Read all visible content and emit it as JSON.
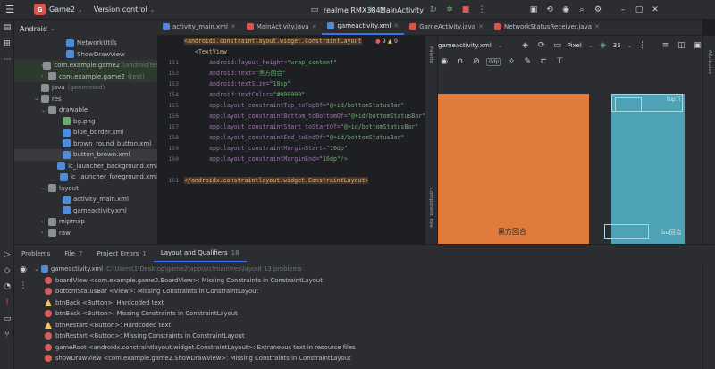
{
  "titlebar": {
    "project_badge": "G",
    "project": "Game2",
    "version_control": "Version control",
    "device": "realme RMX3841",
    "run_config": "MainActivity"
  },
  "left_strip_icons": [
    "folder-icon",
    "grid-icon",
    "ellipsis-icon"
  ],
  "tree": {
    "header": "Android",
    "rows": [
      {
        "label": "NetworkUtils",
        "indent": 50,
        "icon": "blue",
        "arrow": ""
      },
      {
        "label": "ShowDrawView",
        "indent": 50,
        "icon": "blue",
        "arrow": ""
      },
      {
        "label": "com.example.game2",
        "suffix": "(androidTest)",
        "indent": 30,
        "icon": "folder",
        "arrow": "›",
        "green": true
      },
      {
        "label": "com.example.game2",
        "suffix": "(test)",
        "indent": 30,
        "icon": "folder",
        "arrow": "›",
        "green": true
      },
      {
        "label": "java",
        "suffix": "(generated)",
        "indent": 22,
        "icon": "folder",
        "arrow": ""
      },
      {
        "label": "res",
        "indent": 22,
        "icon": "folder",
        "arrow": "⌄"
      },
      {
        "label": "drawable",
        "indent": 30,
        "icon": "folder",
        "arrow": "⌄"
      },
      {
        "label": "bg.png",
        "indent": 46,
        "icon": "img",
        "arrow": ""
      },
      {
        "label": "blue_border.xml",
        "indent": 46,
        "icon": "xml",
        "arrow": ""
      },
      {
        "label": "brown_round_button.xml",
        "indent": 46,
        "icon": "xml",
        "arrow": ""
      },
      {
        "label": "button_brown.xml",
        "indent": 46,
        "icon": "xml",
        "arrow": "",
        "selected": true
      },
      {
        "label": "ic_launcher_background.xml",
        "indent": 46,
        "icon": "xml",
        "arrow": ""
      },
      {
        "label": "ic_launcher_foreground.xml",
        "indent": 46,
        "icon": "xml",
        "arrow": ""
      },
      {
        "label": "layout",
        "indent": 30,
        "icon": "folder",
        "arrow": "⌄"
      },
      {
        "label": "activity_main.xml",
        "indent": 46,
        "icon": "xml",
        "arrow": ""
      },
      {
        "label": "gameactivity.xml",
        "indent": 46,
        "icon": "xml",
        "arrow": ""
      },
      {
        "label": "mipmap",
        "indent": 30,
        "icon": "folder",
        "arrow": "›"
      },
      {
        "label": "raw",
        "indent": 30,
        "icon": "folder",
        "arrow": "›"
      }
    ]
  },
  "tabs": [
    {
      "label": "activity_main.xml",
      "active": false,
      "color": "#4f8bd6"
    },
    {
      "label": "MainActivity.java",
      "active": false,
      "color": "#d9534f"
    },
    {
      "label": "gameactivity.xml",
      "active": true,
      "color": "#4f8bd6"
    },
    {
      "label": "GameActivity.java",
      "active": false,
      "color": "#d9534f"
    },
    {
      "label": "NetworkStatusReceiver.java",
      "active": false,
      "color": "#d9534f"
    }
  ],
  "gutter": [
    "",
    "",
    "151",
    "152",
    "153",
    "154",
    "155",
    "156",
    "157",
    "158",
    "159",
    "160",
    "",
    "161"
  ],
  "editor": {
    "warnings": {
      "errors": "9",
      "warns": "9"
    },
    "lines": [
      {
        "tag": "<androidx.constraintlayout.widget.ConstraintLayout",
        "hl": true,
        "indent": 0
      },
      {
        "tag": "<TextView",
        "indent": 12
      },
      {
        "attr": "android:layout_height=",
        "val": "\"wrap_content\"",
        "indent": 28
      },
      {
        "attr": "android:text=",
        "val": "\"黑方回合\"",
        "indent": 28
      },
      {
        "attr": "android:textSize=",
        "val": "\"18sp\"",
        "indent": 28
      },
      {
        "attr": "android:textColor=",
        "val": "\"#000000\"",
        "indent": 28
      },
      {
        "attr": "app:layout_constraintTop_toTopOf=",
        "val": "\"@+id/bottomStatusBar\"",
        "indent": 28
      },
      {
        "attr": "app:layout_constraintBottom_toBottomOf=",
        "val": "\"@+id/bottomStatusBar\"",
        "indent": 28
      },
      {
        "attr": "app:layout_constraintStart_toStartOf=",
        "val": "\"@+id/bottomStatusBar\"",
        "indent": 28
      },
      {
        "attr": "app:layout_constraintEnd_toEndOf=",
        "val": "\"@+id/bottomStatusBar\"",
        "indent": 28
      },
      {
        "attr": "app:layout_constraintMarginStart=",
        "val": "\"16dp\"",
        "indent": 28
      },
      {
        "attr": "app:layout_constraintMarginEnd=",
        "val": "\"16dp\"/>",
        "indent": 28
      },
      {
        "tag": "",
        "indent": 0
      },
      {
        "tag": "</androidx.constraintlayout.widget.ConstraintLayout>",
        "hl": true,
        "indent": 0
      }
    ]
  },
  "preview": {
    "file": "gameactivity.xml",
    "device": "Pixel",
    "api": "35",
    "dp_value": "0dp",
    "label_board": "黑方回合",
    "label_right": "bo回合",
    "label_topright": "topTi"
  },
  "preview_side": {
    "palette": "Palette",
    "component_tree": "Component Tree"
  },
  "right_strip": {
    "attributes": "Attributes"
  },
  "bottom": {
    "tabs": [
      {
        "label": "Problems",
        "count": "",
        "active": false
      },
      {
        "label": "File",
        "count": "7",
        "active": false
      },
      {
        "label": "Project Errors",
        "count": "1",
        "active": false
      },
      {
        "label": "Layout and Qualifiers",
        "count": "18",
        "active": true
      }
    ],
    "file_row": {
      "name": "gameactivity.xml",
      "path": "C:\\Users\\1\\Desktop\\game2\\app\\src\\main\\res\\layout  13 problems"
    },
    "problems": [
      {
        "type": "error",
        "text": "boardView <com.example.game2.BoardView>: Missing Constraints in ConstraintLayout"
      },
      {
        "type": "error",
        "text": "bottomStatusBar <View>: Missing Constraints in ConstraintLayout"
      },
      {
        "type": "warning",
        "text": "btnBack <Button>: Hardcoded text"
      },
      {
        "type": "error",
        "text": "btnBack <Button>: Missing Constraints in ConstraintLayout"
      },
      {
        "type": "warning",
        "text": "btnRestart <Button>: Hardcoded text"
      },
      {
        "type": "error",
        "text": "btnRestart <Button>: Missing Constraints in ConstraintLayout"
      },
      {
        "type": "error",
        "text": "gameRoot <androidx.constraintlayout.widget.ConstraintLayout>: Extraneous text in resource files"
      },
      {
        "type": "error",
        "text": "showDrawView <com.example.game2.ShowDrawView>: Missing Constraints in ConstraintLayout"
      }
    ]
  }
}
